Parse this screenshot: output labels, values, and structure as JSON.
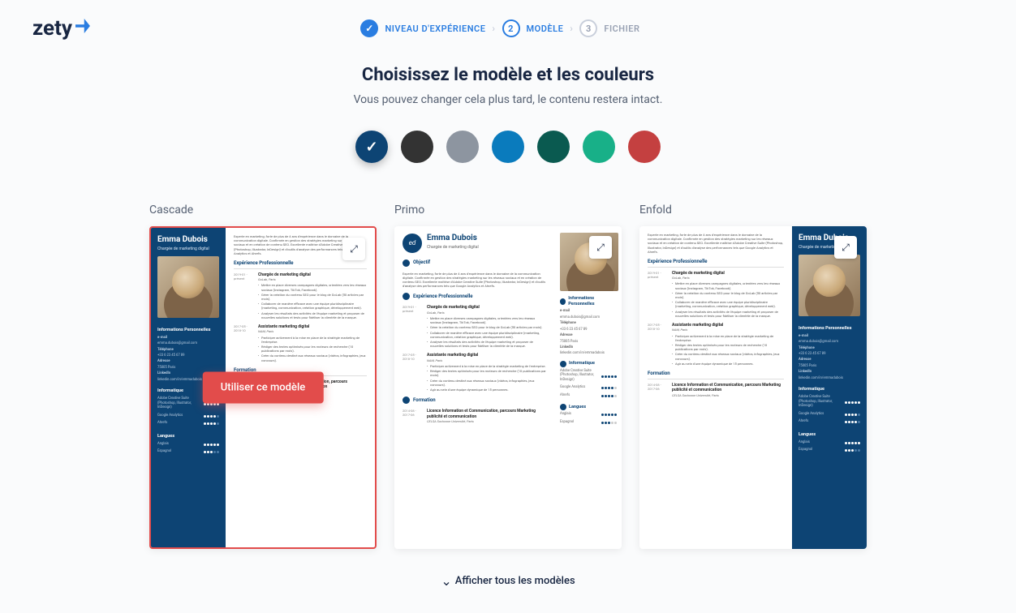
{
  "logo": "zety",
  "steps": {
    "s1": {
      "label": "NIVEAU D'EXPÉRIENCE"
    },
    "s2": {
      "num": "2",
      "label": "MODÈLE"
    },
    "s3": {
      "num": "3",
      "label": "FICHIER"
    }
  },
  "title": "Choisissez le modèle et les couleurs",
  "subtitle": "Vous pouvez changer cela plus tard, le contenu restera intact.",
  "colors": [
    {
      "hex": "#0d4474",
      "selected": true
    },
    {
      "hex": "#333333",
      "selected": false
    },
    {
      "hex": "#8d95a0",
      "selected": false
    },
    {
      "hex": "#0a7bbd",
      "selected": false
    },
    {
      "hex": "#0a5a50",
      "selected": false
    },
    {
      "hex": "#18b088",
      "selected": false
    },
    {
      "hex": "#c44040",
      "selected": false
    }
  ],
  "templates": {
    "t1": {
      "name": "Cascade",
      "selected": true
    },
    "t2": {
      "name": "Primo",
      "selected": false
    },
    "t3": {
      "name": "Enfold",
      "selected": false
    }
  },
  "use_button": "Utiliser ce modèle",
  "show_all": "Afficher tous les modèles",
  "cv": {
    "name": "Emma Dubois",
    "role": "Chargée de marketing digital",
    "summary": "Experte en marketing, forte de plus de 4 ans d'expérience dans le domaine de la communication digitale. Confirmée en gestion des stratégies marketing sur les réseaux sociaux et en création de contenu SEO. Excellente maîtrise d'Adobe Creative Suite (Photoshop, Illustrator, InDesign) et d'outils d'analyse des performances tels que Google Analytics et Ahrefs.",
    "sec_info": "Informations Personnelles",
    "email_lbl": "e-mail",
    "email": "emma.dubois@gmail.com",
    "phone_lbl": "Téléphone",
    "phone": "+33 6 23 45 67 89",
    "addr_lbl": "Adresse",
    "addr": "75005 Paris",
    "linkedin_lbl": "LinkedIn",
    "linkedin": "linkedin.com/in/emmadubois",
    "sec_it": "Informatique",
    "it1": "Adobe Creative Suite (Photoshop, Illustrator, InDesign)",
    "it2": "Google Analytics",
    "it3": "Ahrefs",
    "sec_lang": "Langues",
    "lang1": "Anglais",
    "lang2": "Espagnol",
    "sec_obj": "Objectif",
    "sec_exp": "Expérience Professionnelle",
    "job1_date": "2019-01 - présent",
    "job1_title": "Chargée de marketing digital",
    "job1_company": "GoLab, Paris",
    "job1_b1": "Mettre en place diverses campagnes digitales, orientées vers les réseaux sociaux (Instagram, TikTok, Facebook).",
    "job1_b2": "Gérer la création du contenu SEO pour le blog de GoLab (50 articles par mois).",
    "job1_b3": "Collaborer de manière efficace avec une équipe pluridisciplinaire (marketing, communication, création graphique, développement web).",
    "job1_b4": "Analyser les résultats des activités de l'équipe marketing et proposer de nouvelles solutions et tests pour fidéliser la clientèle de la marque.",
    "job2_date": "2017-05 - 2018-10",
    "job2_title": "Assistante marketing digital",
    "job2_company": "NAM, Paris",
    "job2_b1": "Participer activement à la mise en place de la stratégie marketing de l'entreprise.",
    "job2_b2": "Rédiger des textes optimisés pour les moteurs de recherche (10 publications par mois).",
    "job2_b3": "Créer du contenu destiné aux réseaux sociaux (vidéos, infographies, jeux concours).",
    "job2_b4": "Agir au sein d'une équipe dynamique de 15 personnes.",
    "sec_edu": "Formation",
    "edu_date": "2014-08 - 2017-06",
    "edu_title": "Licence Information et Communication, parcours Marketing publicité et communication",
    "edu_school": "CELSA Sorbonne Université, Paris"
  }
}
